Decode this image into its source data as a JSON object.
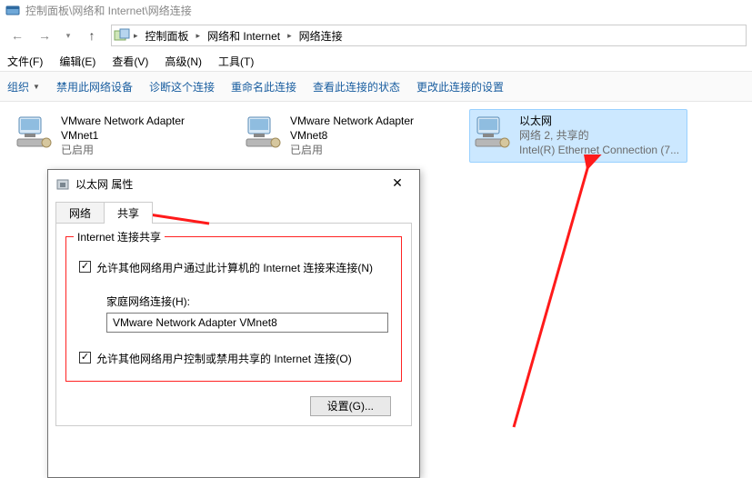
{
  "titlebar": {
    "text": "控制面板\\网络和 Internet\\网络连接"
  },
  "breadcrumbs": {
    "a": "控制面板",
    "b": "网络和 Internet",
    "c": "网络连接"
  },
  "menu": {
    "file": "文件(F)",
    "edit": "编辑(E)",
    "view": "查看(V)",
    "advanced": "高级(N)",
    "tools": "工具(T)"
  },
  "toolbar": {
    "org": "组织",
    "disable": "禁用此网络设备",
    "diagnose": "诊断这个连接",
    "rename": "重命名此连接",
    "status": "查看此连接的状态",
    "change": "更改此连接的设置"
  },
  "adapters": [
    {
      "name": "VMware Network Adapter VMnet1",
      "line2": "",
      "line3": "已启用"
    },
    {
      "name": "VMware Network Adapter VMnet8",
      "line2": "",
      "line3": "已启用"
    },
    {
      "name": "以太网",
      "line2": "网络 2, 共享的",
      "line3": "Intel(R) Ethernet Connection (7..."
    }
  ],
  "dialog": {
    "title": "以太网 属性",
    "tabs": {
      "network": "网络",
      "sharing": "共享"
    },
    "section_title": "Internet 连接共享",
    "allow_connect": "允许其他网络用户通过此计算机的 Internet 连接来连接(N)",
    "home_label": "家庭网络连接(H):",
    "home_value": "VMware Network Adapter VMnet8",
    "allow_control": "允许其他网络用户控制或禁用共享的 Internet 连接(O)",
    "settings_btn": "设置(G)..."
  }
}
